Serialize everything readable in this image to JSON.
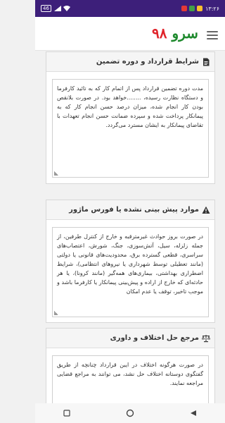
{
  "status_bar": {
    "time": "۱۳:۲۶",
    "battery": "46"
  },
  "app_bar": {
    "title_word": "سرو",
    "title_number": "۹۸"
  },
  "sections": [
    {
      "title": "شرایط قرارداد و دوره تضمین",
      "body": "مدت دوره تضمین قرارداد پس از اتمام کار که به تائید کارفرما و دستگاه نظارت رسیده، ........خواهد بود. در صورت بلانقص بودن کار انجام شده، میزان درصد حسن انجام کار که به پیمانکار پرداخت شده و سپرده ضمانت حسن انجام تعهدات با تقاضای پیمانکار به ایشان مسترد می‌گردد."
    },
    {
      "title": "موارد پیش بینی نشده یا فورس ماژور",
      "body": "در صورت بروز حوادث غیرمترقبه و خارج از کنترل طرفین، از جمله زلزله، سیل، آتش‌سوزی، جنگ، شورش، اعتصاب‌های سراسری، قطعی گسترده برق، محدودیت‌های قانونی یا دولتی (مانند تعطیلی توسط شهرداری یا نیروهای انتظامی)، شرایط اضطراری بهداشتی، بیماری‌های همه‌گیر (مانند کرونا)، یا هر حادثه‌ای که خارج از اراده و پیش‌بینی پیمانکار یا کارفرما باشد و موجب تاخیر، توقف یا عدم امکان"
    },
    {
      "title": "مرجع حل اختلاف و داوری",
      "body": "در صورت هرگونه اختلاف در ایبن قرارداد چنانچه از طریق گفتگوی دوستانه اختلاف حل نشد، می توانند به مراجع قضایی مراجعه نمایند."
    }
  ]
}
